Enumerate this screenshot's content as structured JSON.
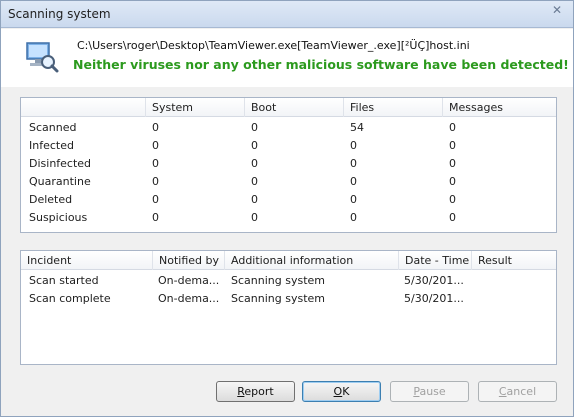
{
  "window": {
    "title": "Scanning system",
    "close_glyph": "✕"
  },
  "header": {
    "icon": "scan-computer-icon",
    "path": "C:\\Users\\roger\\Desktop\\TeamViewer.exe[TeamViewer_.exe][²ÜÇ]host.ini",
    "result": "Neither viruses nor any other malicious software have been detected!",
    "result_color": "#2c9a1e"
  },
  "stats": {
    "columns": [
      "",
      "System",
      "Boot",
      "Files",
      "Messages"
    ],
    "rows": [
      {
        "label": "Scanned",
        "values": [
          "0",
          "0",
          "54",
          "0"
        ]
      },
      {
        "label": "Infected",
        "values": [
          "0",
          "0",
          "0",
          "0"
        ]
      },
      {
        "label": "Disinfected",
        "values": [
          "0",
          "0",
          "0",
          "0"
        ]
      },
      {
        "label": "Quarantine",
        "values": [
          "0",
          "0",
          "0",
          "0"
        ]
      },
      {
        "label": "Deleted",
        "values": [
          "0",
          "0",
          "0",
          "0"
        ]
      },
      {
        "label": "Suspicious",
        "values": [
          "0",
          "0",
          "0",
          "0"
        ]
      }
    ]
  },
  "incidents": {
    "columns": [
      "Incident",
      "Notified by",
      "Additional information",
      "Date - Time",
      "Result"
    ],
    "rows": [
      {
        "incident": "Scan started",
        "notified_by": "On-dema...",
        "info": "Scanning system",
        "datetime": "5/30/201...",
        "result": ""
      },
      {
        "incident": "Scan complete",
        "notified_by": "On-dema...",
        "info": "Scanning system",
        "datetime": "5/30/201...",
        "result": ""
      }
    ]
  },
  "buttons": {
    "report": {
      "pre": "",
      "key": "R",
      "post": "eport",
      "enabled": true
    },
    "ok": {
      "pre": "",
      "key": "O",
      "post": "K",
      "enabled": true,
      "default": true
    },
    "pause": {
      "pre": "",
      "key": "P",
      "post": "ause",
      "enabled": false
    },
    "cancel": {
      "pre": "",
      "key": "C",
      "post": "ancel",
      "enabled": false
    }
  }
}
